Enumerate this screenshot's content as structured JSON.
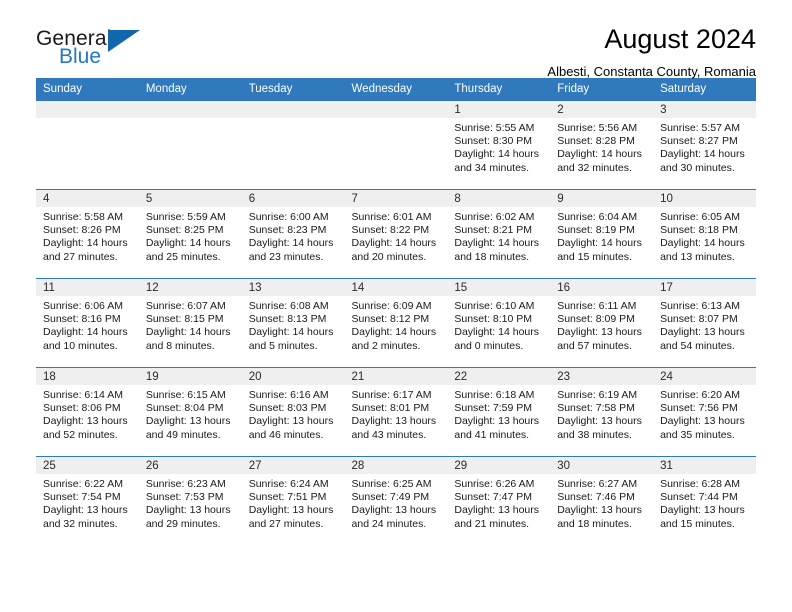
{
  "brand": {
    "name_part1": "General",
    "name_part2": "Blue"
  },
  "header": {
    "title": "August 2024",
    "subtitle": "Albesti, Constanta County, Romania"
  },
  "colors": {
    "header_blue": "#3079bd",
    "brand_blue": "#2079c7",
    "daynum_band": "#efefef"
  },
  "weekdays": [
    "Sunday",
    "Monday",
    "Tuesday",
    "Wednesday",
    "Thursday",
    "Friday",
    "Saturday"
  ],
  "labels": {
    "sunrise_prefix": "Sunrise:",
    "sunset_prefix": "Sunset:",
    "daylight_prefix": "Daylight:"
  },
  "weeks": [
    [
      {
        "day": "",
        "sunrise": "",
        "sunset": "",
        "daylight_line1": "",
        "daylight_line2": ""
      },
      {
        "day": "",
        "sunrise": "",
        "sunset": "",
        "daylight_line1": "",
        "daylight_line2": ""
      },
      {
        "day": "",
        "sunrise": "",
        "sunset": "",
        "daylight_line1": "",
        "daylight_line2": ""
      },
      {
        "day": "",
        "sunrise": "",
        "sunset": "",
        "daylight_line1": "",
        "daylight_line2": ""
      },
      {
        "day": "1",
        "sunrise": "Sunrise: 5:55 AM",
        "sunset": "Sunset: 8:30 PM",
        "daylight_line1": "Daylight: 14 hours",
        "daylight_line2": "and 34 minutes."
      },
      {
        "day": "2",
        "sunrise": "Sunrise: 5:56 AM",
        "sunset": "Sunset: 8:28 PM",
        "daylight_line1": "Daylight: 14 hours",
        "daylight_line2": "and 32 minutes."
      },
      {
        "day": "3",
        "sunrise": "Sunrise: 5:57 AM",
        "sunset": "Sunset: 8:27 PM",
        "daylight_line1": "Daylight: 14 hours",
        "daylight_line2": "and 30 minutes."
      }
    ],
    [
      {
        "day": "4",
        "sunrise": "Sunrise: 5:58 AM",
        "sunset": "Sunset: 8:26 PM",
        "daylight_line1": "Daylight: 14 hours",
        "daylight_line2": "and 27 minutes."
      },
      {
        "day": "5",
        "sunrise": "Sunrise: 5:59 AM",
        "sunset": "Sunset: 8:25 PM",
        "daylight_line1": "Daylight: 14 hours",
        "daylight_line2": "and 25 minutes."
      },
      {
        "day": "6",
        "sunrise": "Sunrise: 6:00 AM",
        "sunset": "Sunset: 8:23 PM",
        "daylight_line1": "Daylight: 14 hours",
        "daylight_line2": "and 23 minutes."
      },
      {
        "day": "7",
        "sunrise": "Sunrise: 6:01 AM",
        "sunset": "Sunset: 8:22 PM",
        "daylight_line1": "Daylight: 14 hours",
        "daylight_line2": "and 20 minutes."
      },
      {
        "day": "8",
        "sunrise": "Sunrise: 6:02 AM",
        "sunset": "Sunset: 8:21 PM",
        "daylight_line1": "Daylight: 14 hours",
        "daylight_line2": "and 18 minutes."
      },
      {
        "day": "9",
        "sunrise": "Sunrise: 6:04 AM",
        "sunset": "Sunset: 8:19 PM",
        "daylight_line1": "Daylight: 14 hours",
        "daylight_line2": "and 15 minutes."
      },
      {
        "day": "10",
        "sunrise": "Sunrise: 6:05 AM",
        "sunset": "Sunset: 8:18 PM",
        "daylight_line1": "Daylight: 14 hours",
        "daylight_line2": "and 13 minutes."
      }
    ],
    [
      {
        "day": "11",
        "sunrise": "Sunrise: 6:06 AM",
        "sunset": "Sunset: 8:16 PM",
        "daylight_line1": "Daylight: 14 hours",
        "daylight_line2": "and 10 minutes."
      },
      {
        "day": "12",
        "sunrise": "Sunrise: 6:07 AM",
        "sunset": "Sunset: 8:15 PM",
        "daylight_line1": "Daylight: 14 hours",
        "daylight_line2": "and 8 minutes."
      },
      {
        "day": "13",
        "sunrise": "Sunrise: 6:08 AM",
        "sunset": "Sunset: 8:13 PM",
        "daylight_line1": "Daylight: 14 hours",
        "daylight_line2": "and 5 minutes."
      },
      {
        "day": "14",
        "sunrise": "Sunrise: 6:09 AM",
        "sunset": "Sunset: 8:12 PM",
        "daylight_line1": "Daylight: 14 hours",
        "daylight_line2": "and 2 minutes."
      },
      {
        "day": "15",
        "sunrise": "Sunrise: 6:10 AM",
        "sunset": "Sunset: 8:10 PM",
        "daylight_line1": "Daylight: 14 hours",
        "daylight_line2": "and 0 minutes."
      },
      {
        "day": "16",
        "sunrise": "Sunrise: 6:11 AM",
        "sunset": "Sunset: 8:09 PM",
        "daylight_line1": "Daylight: 13 hours",
        "daylight_line2": "and 57 minutes."
      },
      {
        "day": "17",
        "sunrise": "Sunrise: 6:13 AM",
        "sunset": "Sunset: 8:07 PM",
        "daylight_line1": "Daylight: 13 hours",
        "daylight_line2": "and 54 minutes."
      }
    ],
    [
      {
        "day": "18",
        "sunrise": "Sunrise: 6:14 AM",
        "sunset": "Sunset: 8:06 PM",
        "daylight_line1": "Daylight: 13 hours",
        "daylight_line2": "and 52 minutes."
      },
      {
        "day": "19",
        "sunrise": "Sunrise: 6:15 AM",
        "sunset": "Sunset: 8:04 PM",
        "daylight_line1": "Daylight: 13 hours",
        "daylight_line2": "and 49 minutes."
      },
      {
        "day": "20",
        "sunrise": "Sunrise: 6:16 AM",
        "sunset": "Sunset: 8:03 PM",
        "daylight_line1": "Daylight: 13 hours",
        "daylight_line2": "and 46 minutes."
      },
      {
        "day": "21",
        "sunrise": "Sunrise: 6:17 AM",
        "sunset": "Sunset: 8:01 PM",
        "daylight_line1": "Daylight: 13 hours",
        "daylight_line2": "and 43 minutes."
      },
      {
        "day": "22",
        "sunrise": "Sunrise: 6:18 AM",
        "sunset": "Sunset: 7:59 PM",
        "daylight_line1": "Daylight: 13 hours",
        "daylight_line2": "and 41 minutes."
      },
      {
        "day": "23",
        "sunrise": "Sunrise: 6:19 AM",
        "sunset": "Sunset: 7:58 PM",
        "daylight_line1": "Daylight: 13 hours",
        "daylight_line2": "and 38 minutes."
      },
      {
        "day": "24",
        "sunrise": "Sunrise: 6:20 AM",
        "sunset": "Sunset: 7:56 PM",
        "daylight_line1": "Daylight: 13 hours",
        "daylight_line2": "and 35 minutes."
      }
    ],
    [
      {
        "day": "25",
        "sunrise": "Sunrise: 6:22 AM",
        "sunset": "Sunset: 7:54 PM",
        "daylight_line1": "Daylight: 13 hours",
        "daylight_line2": "and 32 minutes."
      },
      {
        "day": "26",
        "sunrise": "Sunrise: 6:23 AM",
        "sunset": "Sunset: 7:53 PM",
        "daylight_line1": "Daylight: 13 hours",
        "daylight_line2": "and 29 minutes."
      },
      {
        "day": "27",
        "sunrise": "Sunrise: 6:24 AM",
        "sunset": "Sunset: 7:51 PM",
        "daylight_line1": "Daylight: 13 hours",
        "daylight_line2": "and 27 minutes."
      },
      {
        "day": "28",
        "sunrise": "Sunrise: 6:25 AM",
        "sunset": "Sunset: 7:49 PM",
        "daylight_line1": "Daylight: 13 hours",
        "daylight_line2": "and 24 minutes."
      },
      {
        "day": "29",
        "sunrise": "Sunrise: 6:26 AM",
        "sunset": "Sunset: 7:47 PM",
        "daylight_line1": "Daylight: 13 hours",
        "daylight_line2": "and 21 minutes."
      },
      {
        "day": "30",
        "sunrise": "Sunrise: 6:27 AM",
        "sunset": "Sunset: 7:46 PM",
        "daylight_line1": "Daylight: 13 hours",
        "daylight_line2": "and 18 minutes."
      },
      {
        "day": "31",
        "sunrise": "Sunrise: 6:28 AM",
        "sunset": "Sunset: 7:44 PM",
        "daylight_line1": "Daylight: 13 hours",
        "daylight_line2": "and 15 minutes."
      }
    ]
  ]
}
